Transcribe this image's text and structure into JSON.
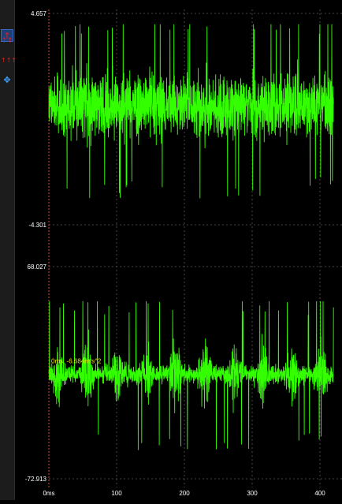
{
  "toolbar": {
    "tools": [
      {
        "name": "single-cursor-icon",
        "glyph": "↑",
        "color": "#e02020",
        "active": true
      },
      {
        "name": "double-cursor-icon",
        "glyph": "↑↑",
        "color": "#e02020",
        "active": false
      },
      {
        "name": "triple-cursor-icon",
        "glyph": "↑↑↑",
        "color": "#e02020",
        "active": false
      },
      {
        "name": "pan-move-icon",
        "glyph": "✥",
        "color": "#3fa0ff",
        "active": false
      }
    ]
  },
  "colors": {
    "signal": "#33ff00",
    "cursor_label": "#e6e600",
    "axis_text": "#ffffff",
    "grid": "#5a5a5a",
    "cursor_line": "#ff6040"
  },
  "chart_data": [
    {
      "type": "line",
      "title": "",
      "ylim": [
        -4.301,
        4.657
      ],
      "y_tick_labels": [
        "4.657",
        "-4.301"
      ],
      "xlim": [
        0,
        420
      ],
      "series": [
        {
          "description": "dense noise signal",
          "mean": 0.75,
          "typical_range": [
            -2.0,
            3.4
          ],
          "peak_range": [
            -3.9,
            4.2
          ]
        }
      ]
    },
    {
      "type": "line",
      "title": "",
      "ylim": [
        -72.913,
        68.027
      ],
      "y_tick_labels": [
        "68.027",
        "-72.913"
      ],
      "xlim": [
        0,
        420
      ],
      "x_tick_labels": [
        "0ms",
        "100",
        "200",
        "300",
        "400"
      ],
      "x_ticks": [
        0,
        100,
        200,
        300,
        400
      ],
      "burst_period_ms": 43,
      "series": [
        {
          "description": "periodic impulsive vibration signal",
          "mean": -3.5,
          "typical_range": [
            -30,
            22
          ],
          "peak_range": [
            -60,
            45
          ]
        }
      ],
      "cursor": {
        "x": 0,
        "label": "0ms, -6.684m/s^2"
      }
    }
  ]
}
